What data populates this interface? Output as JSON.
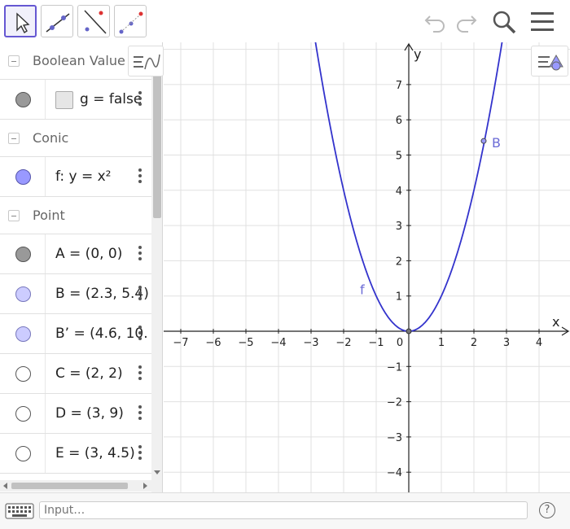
{
  "toolbar": {
    "tools": [
      "move-tool",
      "line-tool",
      "perpendicular-line-tool",
      "point-tool"
    ],
    "active_tool": "move-tool"
  },
  "algebra": {
    "sections": [
      {
        "header": "Boolean Value",
        "items": [
          {
            "text": "g = false",
            "marker": "checkbox"
          }
        ]
      },
      {
        "header": "Conic",
        "items": [
          {
            "text": "f: y = x²",
            "marker": "#9999ff"
          }
        ]
      },
      {
        "header": "Point",
        "items": [
          {
            "text": "A = (0, 0)",
            "marker": "#999999"
          },
          {
            "text": "B = (2.3, 5.4)",
            "marker": "#ccccff"
          },
          {
            "text": "B’ = (4.6, 10.",
            "marker": "#ccccff"
          },
          {
            "text": "C = (2, 2)",
            "marker": "#ffffff"
          },
          {
            "text": "D = (3, 9)",
            "marker": "#ffffff"
          },
          {
            "text": "E = (3, 4.5)",
            "marker": "#ffffff"
          }
        ]
      }
    ]
  },
  "graphics": {
    "x_ticks": [
      "−7",
      "−6",
      "−5",
      "−4",
      "−3",
      "−2",
      "−1",
      "0",
      "1",
      "2",
      "3",
      "4"
    ],
    "y_ticks_pos": [
      "1",
      "2",
      "3",
      "4",
      "5",
      "6",
      "7"
    ],
    "y_ticks_neg": [
      "−1",
      "−2",
      "−3",
      "−4"
    ],
    "x_axis_label": "x",
    "y_axis_label": "y",
    "curve_label": "f",
    "point_label": "B",
    "point_B": {
      "x": 2.3,
      "y": 5.4
    },
    "point_A": {
      "x": 0,
      "y": 0
    },
    "curve_color": "#3333cc",
    "point_label_color": "#6b6bd6"
  },
  "input": {
    "placeholder": "Input…",
    "help": "?"
  }
}
